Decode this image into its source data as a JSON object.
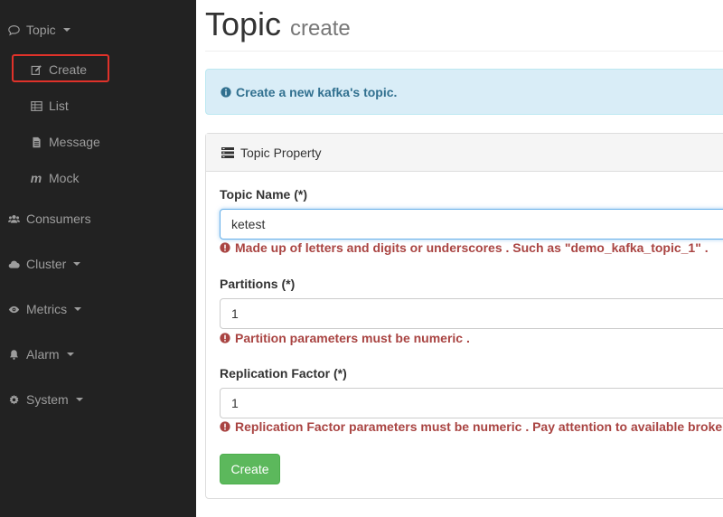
{
  "sidebar": {
    "topic": {
      "label": "Topic",
      "icon": "comments-icon"
    },
    "sub_items": {
      "create": {
        "label": "Create",
        "icon": "edit-icon"
      },
      "list": {
        "label": "List",
        "icon": "table-icon"
      },
      "message": {
        "label": "Message",
        "icon": "file-text-icon"
      },
      "mock": {
        "label": "Mock",
        "icon": "mock-m-icon"
      }
    },
    "consumers": {
      "label": "Consumers",
      "icon": "users-icon"
    },
    "cluster": {
      "label": "Cluster",
      "icon": "cloud-icon"
    },
    "metrics": {
      "label": "Metrics",
      "icon": "eye-icon"
    },
    "alarm": {
      "label": "Alarm",
      "icon": "bell-icon"
    },
    "system": {
      "label": "System",
      "icon": "cog-icon"
    }
  },
  "header": {
    "title": "Topic",
    "subtitle": "create"
  },
  "alert": {
    "text": "Create a new kafka's topic."
  },
  "panel": {
    "heading": "Topic Property",
    "fields": {
      "topic_name": {
        "label": "Topic Name (*)",
        "value": "ketest",
        "error": "Made up of letters and digits or underscores . Such as \"demo_kafka_topic_1\" ."
      },
      "partitions": {
        "label": "Partitions (*)",
        "value": "1",
        "error": "Partition parameters must be numeric ."
      },
      "replication": {
        "label": "Replication Factor (*)",
        "value": "1",
        "error": "Replication Factor parameters must be numeric . Pay attention to available brokers"
      }
    },
    "submit_label": "Create"
  },
  "colors": {
    "sidebar_bg": "#222222",
    "highlight": "#e0322a",
    "alert_bg": "#d9edf7",
    "alert_text": "#31708f",
    "error_text": "#a94442",
    "success_button": "#5cb85c"
  }
}
